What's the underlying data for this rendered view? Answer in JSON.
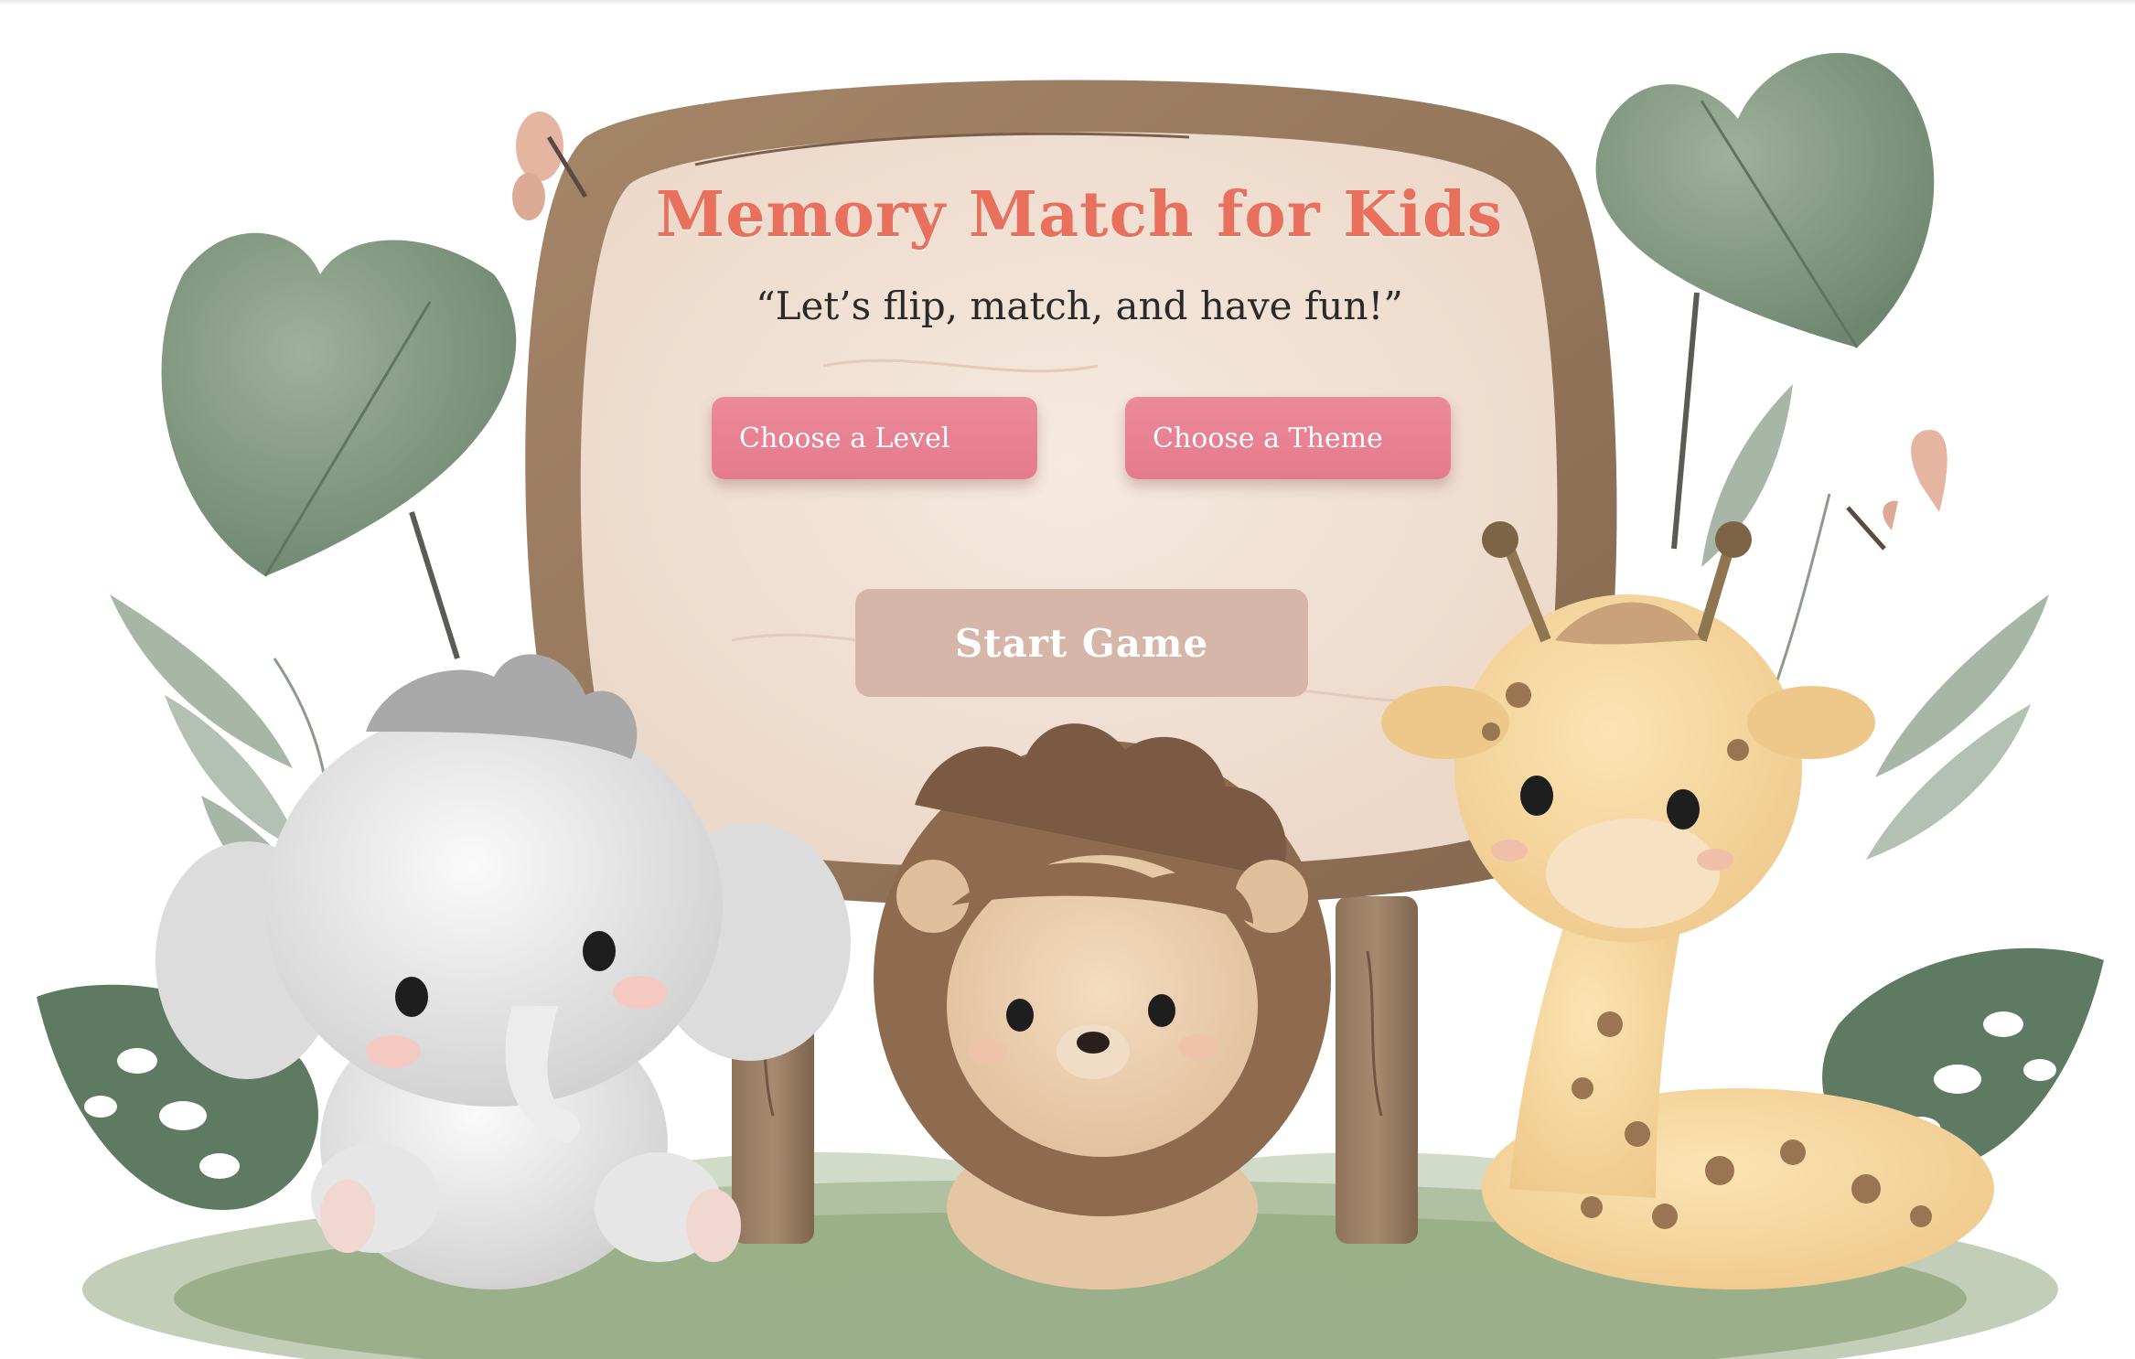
{
  "game": {
    "title": "Memory Match for Kids",
    "tagline": "“Let’s flip, match, and have fun!”"
  },
  "menu": {
    "choose_level_label": "Choose a Level",
    "choose_theme_label": "Choose a Theme",
    "start_label": "Start Game"
  },
  "colors": {
    "title": "#e8705c",
    "menu_button": "#e57a8c",
    "start_button": "#d6b6a9",
    "sign_panel": "#f3e3d6",
    "sign_frame": "#9a7b63"
  },
  "decorations": [
    "leaf-icon",
    "butterfly-icon",
    "elephant-icon",
    "lion-icon",
    "giraffe-icon",
    "grass-icon"
  ]
}
